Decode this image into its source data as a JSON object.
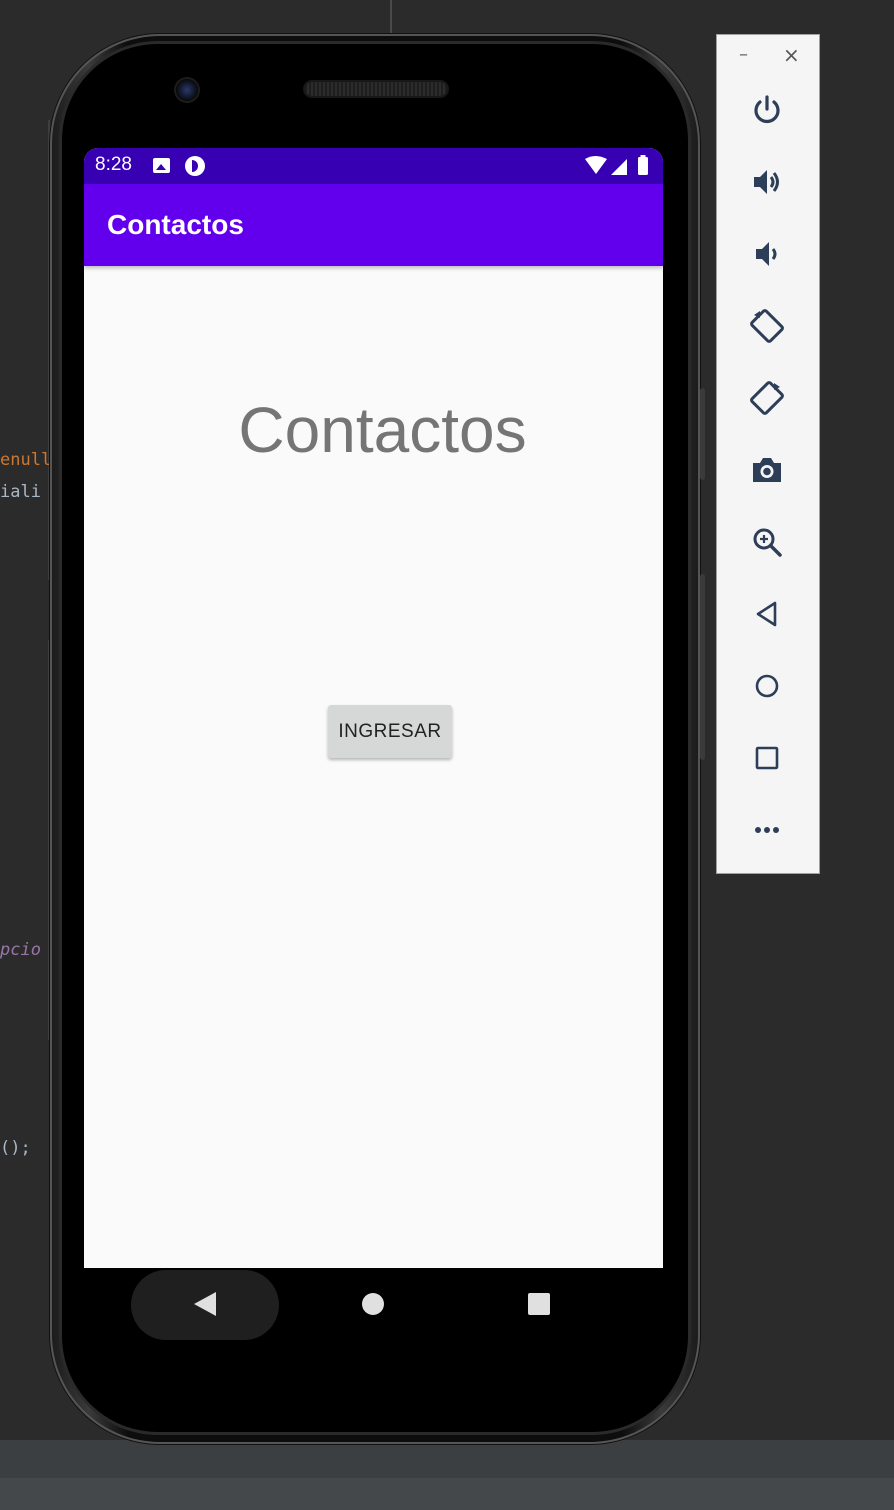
{
  "ide": {
    "code_fragments": [
      "enull",
      "iali",
      "pcio",
      "();"
    ],
    "colors": {
      "background": "#2b2b2b",
      "keyword_orange": "#cc7832",
      "text_gray": "#a9b7c6",
      "italic_purple": "#9876aa"
    }
  },
  "device": {
    "status_bar": {
      "time": "8:28",
      "icons": [
        "image-icon",
        "app-notification-icon",
        "wifi-icon",
        "cellular-signal-icon",
        "battery-icon"
      ]
    },
    "app_bar": {
      "title": "Contactos"
    },
    "main": {
      "heading": "Contactos",
      "button_label": "INGRESAR"
    },
    "nav_bar": {
      "icons": [
        "back-icon",
        "home-icon",
        "recent-apps-icon"
      ]
    },
    "colors": {
      "status_bar": "#3700b3",
      "app_bar": "#6200ee",
      "screen_bg": "#fafafa",
      "heading_text": "#757575",
      "button_bg": "#d6d7d7"
    }
  },
  "emulator_toolbar": {
    "window_controls": [
      "minimize-icon",
      "close-icon"
    ],
    "minimize_glyph": "–",
    "close_glyph": "×",
    "buttons": [
      {
        "name": "power-icon"
      },
      {
        "name": "volume-up-icon"
      },
      {
        "name": "volume-down-icon"
      },
      {
        "name": "rotate-left-icon"
      },
      {
        "name": "rotate-right-icon"
      },
      {
        "name": "screenshot-camera-icon"
      },
      {
        "name": "zoom-icon"
      },
      {
        "name": "back-icon"
      },
      {
        "name": "home-icon"
      },
      {
        "name": "overview-icon"
      },
      {
        "name": "more-options-icon"
      }
    ]
  }
}
